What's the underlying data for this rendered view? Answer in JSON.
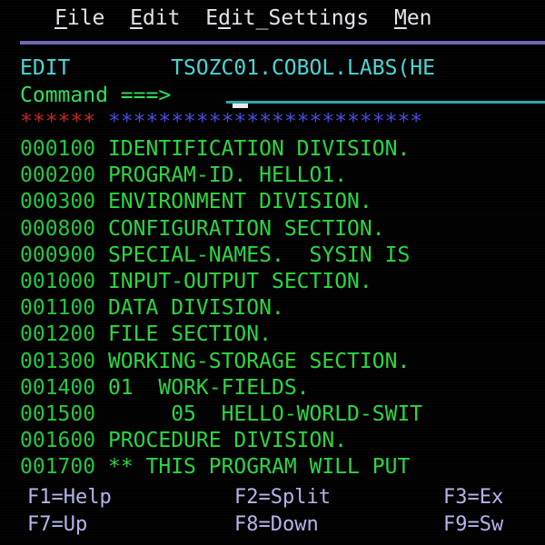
{
  "screen": {
    "type": "ispf-edit-session",
    "background_color": "#000000",
    "columns": 31,
    "rows": 20
  },
  "menubar": {
    "items": [
      {
        "name": "file",
        "label": "File",
        "mnemonic": "F"
      },
      {
        "name": "edit",
        "label": "Edit",
        "mnemonic": "E"
      },
      {
        "name": "edit_settings",
        "label": "Edit_Settings",
        "mnemonic": "d"
      },
      {
        "name": "menu",
        "label": "Men",
        "mnemonic": "M"
      }
    ],
    "text_color": "#e2e2ea",
    "rule_color": "#6a6ab4"
  },
  "header": {
    "mode_label": "EDIT",
    "dataset_name": "TSOZC01.COBOL.LABS(HE",
    "color": "#49d6d6"
  },
  "command_line": {
    "label": "Command ===>",
    "value": "",
    "placeholder": "",
    "label_color": "#2ee05a",
    "field_underline_color": "#2aa9a9",
    "cursor_color": "#e8e8f0"
  },
  "separator": {
    "red_asterisks": "******",
    "blue_asterisks": "*************************",
    "red_color": "#cc2222",
    "blue_color": "#4a4ae0"
  },
  "source_lines": [
    {
      "number": "000100",
      "text": "IDENTIFICATION DIVISION."
    },
    {
      "number": "000200",
      "text": "PROGRAM-ID. HELLO1."
    },
    {
      "number": "000300",
      "text": "ENVIRONMENT DIVISION."
    },
    {
      "number": "000800",
      "text": "CONFIGURATION SECTION."
    },
    {
      "number": "000900",
      "text": "SPECIAL-NAMES.  SYSIN IS"
    },
    {
      "number": "001000",
      "text": "INPUT-OUTPUT SECTION."
    },
    {
      "number": "001100",
      "text": "DATA DIVISION."
    },
    {
      "number": "001200",
      "text": "FILE SECTION."
    },
    {
      "number": "001300",
      "text": "WORKING-STORAGE SECTION."
    },
    {
      "number": "001400",
      "text": "01  WORK-FIELDS."
    },
    {
      "number": "001500",
      "text": "     05  HELLO-WORLD-SWIT"
    },
    {
      "number": "001600",
      "text": "PROCEDURE DIVISION."
    },
    {
      "number": "001700",
      "text": "** THIS PROGRAM WILL PUT"
    }
  ],
  "source_colors": {
    "line_number": "#24c83c",
    "source_text": "#2ad63f"
  },
  "function_keys": {
    "color": "#b4b4ec",
    "rows": [
      [
        {
          "name": "f1",
          "label": "F1=Help"
        },
        {
          "name": "f2",
          "label": "F2=Split"
        },
        {
          "name": "f3",
          "label": "F3=Ex"
        }
      ],
      [
        {
          "name": "f7",
          "label": "F7=Up"
        },
        {
          "name": "f8",
          "label": "F8=Down"
        },
        {
          "name": "f9",
          "label": "F9=Sw"
        }
      ]
    ]
  }
}
